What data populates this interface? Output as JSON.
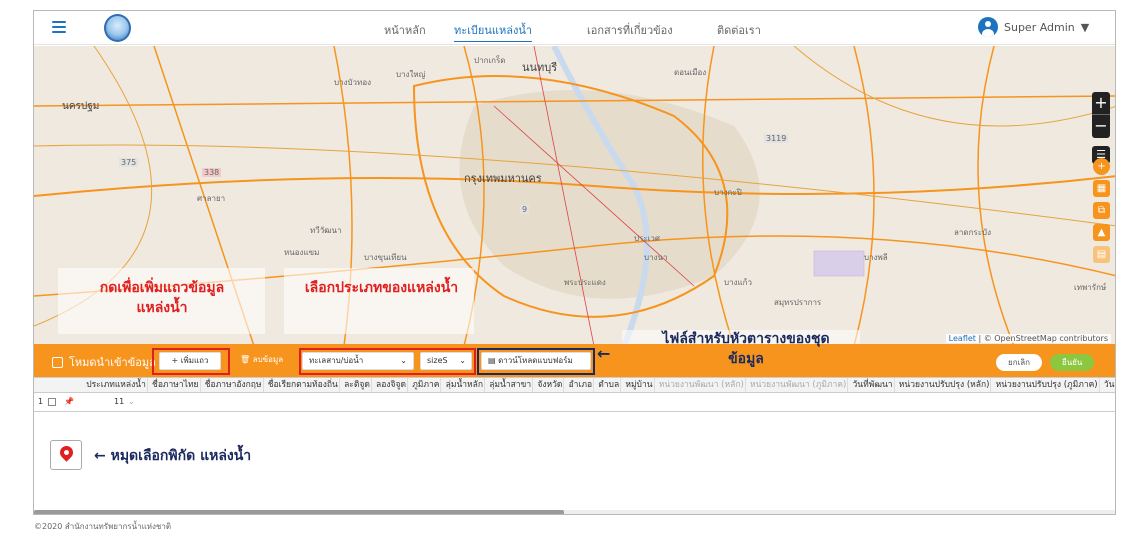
{
  "nav": {
    "home": "หน้าหลัก",
    "register": "ทะเบียนแหล่งน้ำ",
    "docs": "เอกสารที่เกี่ยวข้อง",
    "contact": "ติดต่อเรา"
  },
  "user": {
    "name": "Super Admin"
  },
  "map": {
    "labels": [
      "นนทบุรี",
      "นครปฐม",
      "บางใหญ่",
      "ปากเกร็ด",
      "กรุงเทพมหานคร",
      "บางกะปิ",
      "สมุทรปราการ",
      "ศาลายา",
      "บางพลี",
      "ทวีวัฒนา",
      "พระประแดง",
      "ดอนเมือง",
      "บางบัวทอง",
      "ลาดกระบัง",
      "เทพารักษ์",
      "บางแก้ว",
      "ประเวศ",
      "บางนา",
      "บางขุนเทียน",
      "หนองแขม"
    ],
    "roads": [
      "375",
      "338",
      "3119",
      "9"
    ],
    "attribution": "Leaflet",
    "attribution_osm": "© OpenStreetMap contributors"
  },
  "annotations": {
    "add_row": "กดเพื่อเพิ่มแถวข้อมูล\nแหล่งน้ำ",
    "select_type": "เลือกประเภทของแหล่งน้ำ",
    "template": "ไฟล์สำหรับหัวตารางของชุด\nข้อมูล",
    "pin": "← หมุดเลือกพิกัด แหล่งน้ำ",
    "arrow": "←"
  },
  "toolbar": {
    "title": "โหมดนำเข้าข้อมูล",
    "add_row": "+ เพิ่มแถว",
    "delete": "ลบข้อมูล",
    "type_select": "ทะเลสาบ/บ่อน้ำ",
    "size_select": "sizeS",
    "download": "ดาวน์โหลดแบบฟอร์ม",
    "cancel": "ยกเลิก",
    "confirm": "ยืนยัน"
  },
  "grid": {
    "headers": [
      "ประเภทแหล่งน้ำ",
      "ชื่อภาษาไทย",
      "ชื่อภาษาอังกฤษ",
      "ชื่อเรียกตามท้องถิ่น",
      "ละติจูด",
      "ลองจิจูด",
      "ภูมิภาค",
      "ลุ่มน้ำหลัก",
      "ลุ่มน้ำสาขา",
      "จังหวัด",
      "อำเภอ",
      "ตำบล",
      "หมู่บ้าน",
      "หน่วยงานพัฒนา (หลัก)",
      "หน่วยงานพัฒนา (ภูมิภาค)",
      "วันที่พัฒนา",
      "หน่วยงานปรับปรุง (หลัก)",
      "หน่วยงานปรับปรุง (ภูมิภาค)",
      "วัน"
    ],
    "row_num": "1",
    "row_value": "11"
  },
  "footer": "©2020 สำนักงานทรัพยากรน้ำแห่งชาติ",
  "colors": {
    "accent": "#f7941d",
    "primary": "#1e73be",
    "annotation": "#e02020",
    "navy": "#1a2a5e",
    "confirm": "#8dc63f"
  }
}
